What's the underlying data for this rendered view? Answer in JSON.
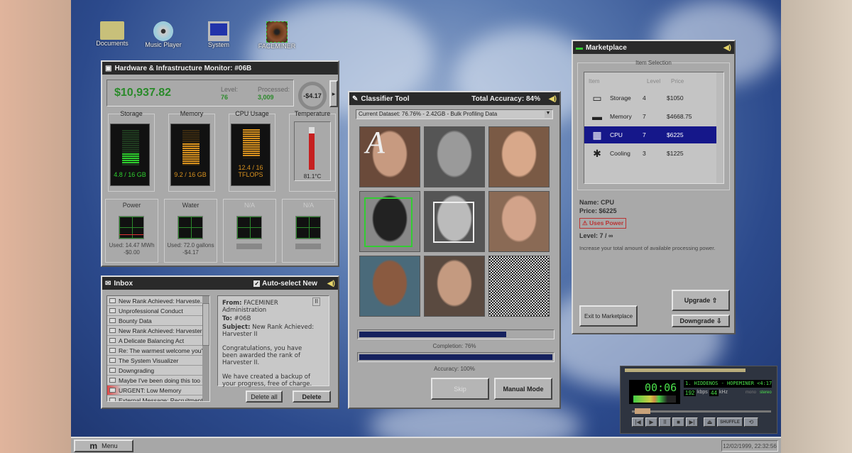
{
  "desktop": {
    "icons": [
      {
        "label": "Documents",
        "icon": "folder-icon"
      },
      {
        "label": "Music Player",
        "icon": "cd-icon"
      },
      {
        "label": "System",
        "icon": "computer-icon"
      },
      {
        "label": "FACEMINER",
        "icon": "eye-icon"
      }
    ]
  },
  "hardware": {
    "title": "Hardware & Infrastructure Monitor: #06B",
    "balance": "$10,937.82",
    "level_label": "Level:",
    "level": "76",
    "processed_label": "Processed:",
    "processed": "3,009",
    "rate": "-$4.17",
    "gauges": [
      {
        "label": "Storage",
        "value": "4.8 / 16 GB",
        "fraction": 0.3,
        "color": "#2ecf2e"
      },
      {
        "label": "Memory",
        "value": "9.2 / 16 GB",
        "fraction": 0.575,
        "color": "#d8911e"
      },
      {
        "label": "CPU Usage",
        "value_line1": "12.4 / 16",
        "value_line2": "TFLOPS",
        "fraction": 0.775,
        "color": "#d8911e"
      }
    ],
    "temperature": {
      "label": "Temperature",
      "value": "81.1°C",
      "fraction": 0.85
    },
    "utilities": [
      {
        "label": "Power",
        "used": "Used: 14.47 MWh",
        "cost": "-$0.00"
      },
      {
        "label": "Water",
        "used": "Used: 72.0 gallons",
        "cost": "-$4.17"
      },
      {
        "label": "N/A"
      },
      {
        "label": "N/A"
      }
    ]
  },
  "inbox": {
    "title": "Inbox",
    "auto_select": "Auto-select New",
    "auto_select_checked": true,
    "messages": [
      "New Rank Achieved: Harveste...",
      "Unprofessional Conduct",
      "Bounty Data",
      "New Rank Achieved: Harvester I",
      "A Delicate Balancing Act",
      "Re: The warmest welcome you'r...",
      "The System Visualizer",
      "Downgrading",
      "Maybe I've been doing this too l...",
      "URGENT: Low Memory",
      "External Message: Recruitment"
    ],
    "reader": {
      "from_label": "From:",
      "from": "FACEMINER Administration",
      "to_label": "To:",
      "to": "#06B",
      "subject_label": "Subject:",
      "subject": "New Rank Achieved: Harvester II",
      "body1": "Congratulations, you have been awarded the rank of Harvester II.",
      "body2": "We have created a backup of your progress, free of charge."
    },
    "delete_all": "Delete all",
    "delete": "Delete"
  },
  "classifier": {
    "title": "Classifier Tool",
    "total_accuracy": "Total Accuracy: 84%",
    "dataset": "Current Dataset: 76.76% - 2.42GB - Bulk Profiling Data",
    "overlay_letter": "A",
    "completion_label": "Completion: 76%",
    "completion": 0.76,
    "accuracy_label": "Accuracy: 100%",
    "accuracy": 1.0,
    "skip": "Skip",
    "manual": "Manual Mode"
  },
  "marketplace": {
    "title": "Marketplace",
    "section": "Item Selection",
    "columns": [
      "Item",
      "Level",
      "Price"
    ],
    "items": [
      {
        "name": "Storage",
        "level": "4",
        "price": "$1050",
        "icon": "drive-icon"
      },
      {
        "name": "Memory",
        "level": "7",
        "price": "$4668.75",
        "icon": "ram-icon"
      },
      {
        "name": "CPU",
        "level": "7",
        "price": "$6225",
        "icon": "chip-icon",
        "selected": true
      },
      {
        "name": "Cooling",
        "level": "3",
        "price": "$1225",
        "icon": "snowflake-icon"
      }
    ],
    "detail": {
      "name": "Name: CPU",
      "price": "Price: $6225",
      "badge": "⚠ Uses Power",
      "level": "Level: 7 / ∞",
      "description": "Increase your total amount of available processing power."
    },
    "exit": "Exit to Marketplace",
    "upgrade": "Upgrade ⇧",
    "downgrade": "Downgrade ⇩"
  },
  "player": {
    "time": "00:06",
    "track": "1. HIDDENOS - HOPEMINER <4:17>",
    "kbps": "192",
    "kbps_label": "kbps",
    "khz": "44",
    "khz_label": "kHz",
    "mono": "mono",
    "stereo": "stereo",
    "shuffle": "SHUFFLE"
  },
  "taskbar": {
    "menu": "Menu",
    "clock": "12/02/1999, 22:32:56"
  }
}
